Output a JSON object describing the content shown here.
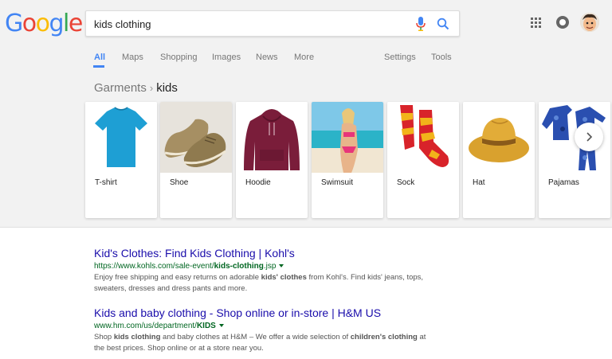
{
  "logo": {
    "letters": [
      "G",
      "o",
      "o",
      "g",
      "l",
      "e"
    ]
  },
  "search": {
    "query": "kids clothing"
  },
  "nav": {
    "all": "All",
    "maps": "Maps",
    "shopping": "Shopping",
    "images": "Images",
    "news": "News",
    "more": "More",
    "settings": "Settings",
    "tools": "Tools"
  },
  "breadcrumb": {
    "parent": "Garments",
    "separator": "›",
    "current": "kids"
  },
  "carousel": {
    "items": [
      {
        "label": "T-shirt",
        "icon": "tshirt-image"
      },
      {
        "label": "Shoe",
        "icon": "shoe-image"
      },
      {
        "label": "Hoodie",
        "icon": "hoodie-image"
      },
      {
        "label": "Swimsuit",
        "icon": "swimsuit-image"
      },
      {
        "label": "Sock",
        "icon": "sock-image"
      },
      {
        "label": "Hat",
        "icon": "hat-image"
      },
      {
        "label": "Pajamas",
        "icon": "pajamas-image"
      }
    ]
  },
  "results": [
    {
      "title": "Kid's Clothes: Find Kids Clothing | Kohl's",
      "url_pre": "https://www.kohls.com/sale-event/",
      "url_bold": "kids-clothing",
      "url_post": ".jsp",
      "snippet": [
        {
          "t": "Enjoy free shipping and easy returns on adorable "
        },
        {
          "t": "kids'",
          "b": true
        },
        {
          "t": " "
        },
        {
          "t": "clothes",
          "b": true
        },
        {
          "t": " from Kohl's. Find kids' jeans, tops, sweaters, dresses and dress pants and more."
        }
      ]
    },
    {
      "title": "Kids and baby clothing - Shop online or in-store | H&M US",
      "url_pre": "www.hm.com/us/department/",
      "url_bold": "KIDS",
      "url_post": "",
      "snippet": [
        {
          "t": "Shop "
        },
        {
          "t": "kids clothing",
          "b": true
        },
        {
          "t": " and baby clothes at H&M – We offer a wide selection of "
        },
        {
          "t": "children's clothing",
          "b": true
        },
        {
          "t": " at the best prices. Shop online or at a store near you."
        }
      ]
    }
  ],
  "colors": {
    "link": "#1a0dab",
    "url": "#006621",
    "snippet": "#545454",
    "accent": "#4285f4"
  }
}
